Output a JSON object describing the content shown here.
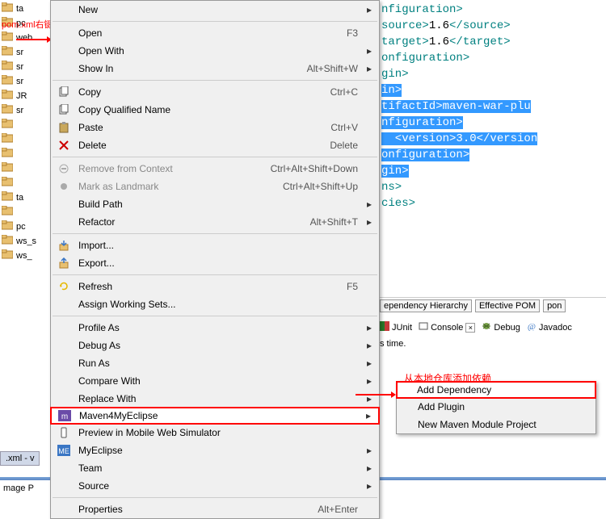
{
  "annotations": {
    "pom_rightclick": "pom.xml右键",
    "add_from_local": "从本地仓库添加依赖"
  },
  "left_tree": {
    "items": [
      {
        "label": "ta"
      },
      {
        "label": "pc"
      },
      {
        "label": "web"
      },
      {
        "label": "sr"
      },
      {
        "label": "sr"
      },
      {
        "label": "sr"
      },
      {
        "label": "JR"
      },
      {
        "label": "sr"
      },
      {
        "label": ""
      },
      {
        "label": ""
      },
      {
        "label": ""
      },
      {
        "label": ""
      },
      {
        "label": ""
      },
      {
        "label": "ta"
      },
      {
        "label": ""
      },
      {
        "label": "pc"
      },
      {
        "label": "ws_s"
      },
      {
        "label": "ws_"
      }
    ]
  },
  "context_menu": {
    "groups": [
      [
        {
          "label": "New",
          "shortcut": "",
          "submenu": true,
          "icon": "",
          "disabled": false
        }
      ],
      [
        {
          "label": "Open",
          "shortcut": "F3",
          "submenu": false,
          "icon": "",
          "disabled": false
        },
        {
          "label": "Open With",
          "shortcut": "",
          "submenu": true,
          "icon": "",
          "disabled": false
        },
        {
          "label": "Show In",
          "shortcut": "Alt+Shift+W",
          "submenu": true,
          "icon": "",
          "disabled": false
        }
      ],
      [
        {
          "label": "Copy",
          "shortcut": "Ctrl+C",
          "submenu": false,
          "icon": "copy",
          "disabled": false
        },
        {
          "label": "Copy Qualified Name",
          "shortcut": "",
          "submenu": false,
          "icon": "copyq",
          "disabled": false
        },
        {
          "label": "Paste",
          "shortcut": "Ctrl+V",
          "submenu": false,
          "icon": "paste",
          "disabled": false
        },
        {
          "label": "Delete",
          "shortcut": "Delete",
          "submenu": false,
          "icon": "delete",
          "disabled": false
        }
      ],
      [
        {
          "label": "Remove from Context",
          "shortcut": "Ctrl+Alt+Shift+Down",
          "submenu": false,
          "icon": "remove",
          "disabled": true
        },
        {
          "label": "Mark as Landmark",
          "shortcut": "Ctrl+Alt+Shift+Up",
          "submenu": false,
          "icon": "mark",
          "disabled": true
        },
        {
          "label": "Build Path",
          "shortcut": "",
          "submenu": true,
          "icon": "",
          "disabled": false
        },
        {
          "label": "Refactor",
          "shortcut": "Alt+Shift+T",
          "submenu": true,
          "icon": "",
          "disabled": false
        }
      ],
      [
        {
          "label": "Import...",
          "shortcut": "",
          "submenu": false,
          "icon": "import",
          "disabled": false
        },
        {
          "label": "Export...",
          "shortcut": "",
          "submenu": false,
          "icon": "export",
          "disabled": false
        }
      ],
      [
        {
          "label": "Refresh",
          "shortcut": "F5",
          "submenu": false,
          "icon": "refresh",
          "disabled": false
        },
        {
          "label": "Assign Working Sets...",
          "shortcut": "",
          "submenu": false,
          "icon": "",
          "disabled": false
        }
      ],
      [
        {
          "label": "Profile As",
          "shortcut": "",
          "submenu": true,
          "icon": "",
          "disabled": false
        },
        {
          "label": "Debug As",
          "shortcut": "",
          "submenu": true,
          "icon": "",
          "disabled": false
        },
        {
          "label": "Run As",
          "shortcut": "",
          "submenu": true,
          "icon": "",
          "disabled": false
        },
        {
          "label": "Compare With",
          "shortcut": "",
          "submenu": true,
          "icon": "",
          "disabled": false
        },
        {
          "label": "Replace With",
          "shortcut": "",
          "submenu": true,
          "icon": "",
          "disabled": false
        },
        {
          "label": "Maven4MyEclipse",
          "shortcut": "",
          "submenu": true,
          "icon": "m4me",
          "disabled": false,
          "highlighted": true
        },
        {
          "label": "Preview in Mobile Web Simulator",
          "shortcut": "",
          "submenu": false,
          "icon": "mobile",
          "disabled": false
        },
        {
          "label": "MyEclipse",
          "shortcut": "",
          "submenu": true,
          "icon": "me",
          "disabled": false
        },
        {
          "label": "Team",
          "shortcut": "",
          "submenu": true,
          "icon": "",
          "disabled": false
        },
        {
          "label": "Source",
          "shortcut": "",
          "submenu": true,
          "icon": "",
          "disabled": false
        }
      ],
      [
        {
          "label": "Properties",
          "shortcut": "Alt+Enter",
          "submenu": false,
          "icon": "",
          "disabled": false
        }
      ]
    ]
  },
  "submenu": {
    "items": [
      {
        "label": "Add Dependency",
        "highlighted": true
      },
      {
        "label": "Add Plugin",
        "highlighted": false
      },
      {
        "label": "New Maven Module Project",
        "highlighted": false
      }
    ]
  },
  "editor": {
    "lines": [
      {
        "parts": [
          {
            "t": "nfiguration>",
            "cls": "tag"
          }
        ]
      },
      {
        "parts": [
          {
            "t": "source>",
            "cls": "tag"
          },
          {
            "t": "1.6",
            "cls": "txt"
          },
          {
            "t": "</source>",
            "cls": "tag"
          }
        ]
      },
      {
        "parts": [
          {
            "t": "target>",
            "cls": "tag"
          },
          {
            "t": "1.6",
            "cls": "txt"
          },
          {
            "t": "</target>",
            "cls": "tag"
          }
        ]
      },
      {
        "parts": [
          {
            "t": "onfiguration>",
            "cls": "tag"
          }
        ]
      },
      {
        "parts": [
          {
            "t": "gin>",
            "cls": "tag"
          }
        ]
      },
      {
        "parts": [
          {
            "t": "in>",
            "cls": "sel"
          }
        ]
      },
      {
        "parts": [
          {
            "t": "tifactId>maven-war-plu",
            "cls": "sel"
          }
        ]
      },
      {
        "parts": [
          {
            "t": "nfiguration>",
            "cls": "sel"
          }
        ]
      },
      {
        "parts": [
          {
            "t": "  <version>3.0</version",
            "cls": "sel"
          }
        ]
      },
      {
        "parts": [
          {
            "t": "onfiguration>",
            "cls": "sel"
          }
        ]
      },
      {
        "parts": [
          {
            "t": "gin>",
            "cls": "sel"
          }
        ]
      },
      {
        "parts": [
          {
            "t": "ns>",
            "cls": "tag"
          }
        ]
      },
      {
        "parts": [
          {
            "t": "",
            "cls": ""
          }
        ]
      },
      {
        "parts": [
          {
            "t": "cies>",
            "cls": "tag"
          }
        ]
      }
    ]
  },
  "tabs": {
    "items": [
      "ependency Hierarchy",
      "Effective POM",
      "pon"
    ]
  },
  "console_tabs": {
    "items": [
      {
        "label": "JUnit",
        "icon": "junit"
      },
      {
        "label": "Console",
        "icon": "console",
        "close": true
      },
      {
        "label": "Debug",
        "icon": "debug"
      },
      {
        "label": "Javadoc",
        "icon": "javadoc"
      }
    ]
  },
  "console_text": "s time.",
  "bottom_tab": ".xml - v",
  "status": "mage P"
}
